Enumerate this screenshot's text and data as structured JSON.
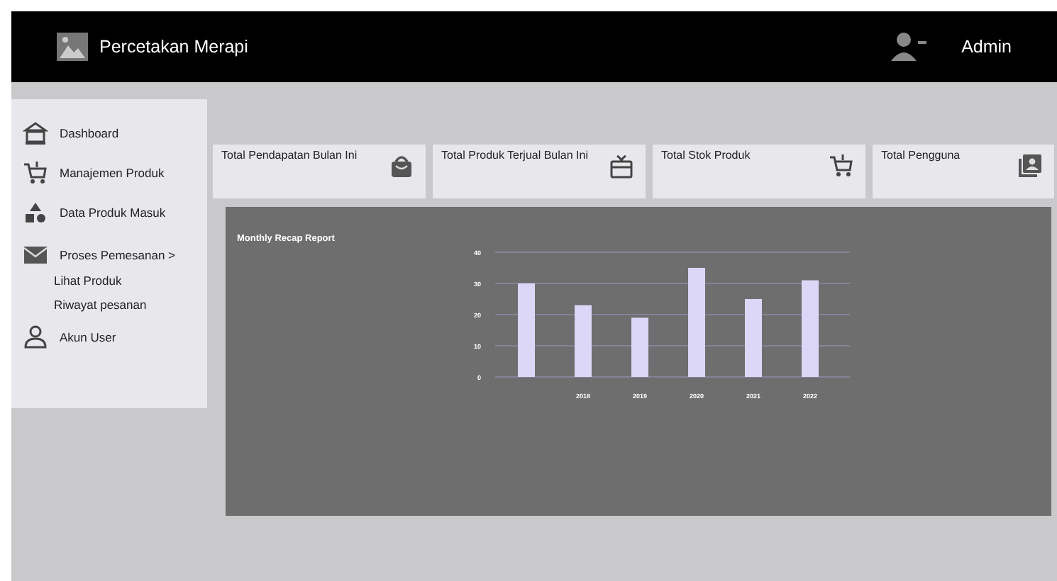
{
  "navbar": {
    "brand": "Percetakan Merapi",
    "user": "Admin"
  },
  "sidebar": {
    "items": [
      {
        "label": "Dashboard"
      },
      {
        "label": "Manajemen Produk"
      },
      {
        "label": "Data Produk Masuk"
      },
      {
        "label": "Proses Pemesanan >",
        "children": [
          {
            "label": "Lihat Produk"
          },
          {
            "label": "Riwayat pesanan"
          }
        ]
      },
      {
        "label": "Akun User"
      }
    ]
  },
  "cards": [
    {
      "label": "Total Pendapatan Bulan Ini"
    },
    {
      "label": "Total Produk Terjual Bulan Ini"
    },
    {
      "label": "Total Stok Produk"
    },
    {
      "label": "Total Pengguna"
    }
  ],
  "report": {
    "title": "Monthly Recap Report",
    "chart_data": {
      "type": "bar",
      "categories": [
        null,
        "2018",
        "2019",
        "2020",
        "2021",
        "2022"
      ],
      "series": [
        {
          "color": "#dcd6f7",
          "values": [
            30,
            23,
            19,
            35,
            25,
            31
          ]
        }
      ],
      "ylim": [
        0,
        40
      ],
      "yticks": [
        0,
        10,
        20,
        30,
        40
      ],
      "grid": true
    }
  }
}
